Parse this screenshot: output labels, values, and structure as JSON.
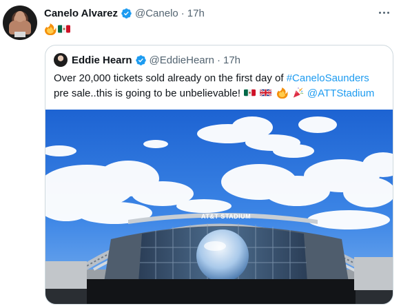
{
  "tweet": {
    "author_name": "Canelo Alvarez",
    "author_handle": "@Canelo",
    "separator": "·",
    "time": "17h",
    "text_emojis": [
      "fire",
      "mexico-flag"
    ]
  },
  "quote": {
    "author_name": "Eddie Hearn",
    "author_handle": "@EddieHearn",
    "separator": "·",
    "time": "17h",
    "text_line1": "Over 20,000 tickets sold already on the first day of",
    "hashtag": "#CaneloSaunders",
    "text_line2": "pre sale..this is going to be unbelievable!",
    "text_line2_emojis": [
      "mexico-flag",
      "uk-flag",
      "fire",
      "party-popper"
    ],
    "mention": "@ATTStadium",
    "image": {
      "sign_text": "AT&T STADIUM",
      "subject": "stadium-photo"
    }
  },
  "colors": {
    "text": "#0f1419",
    "secondary": "#536471",
    "link": "#1d9bf0",
    "border": "#cfd9de",
    "verified": "#1d9bf0"
  }
}
